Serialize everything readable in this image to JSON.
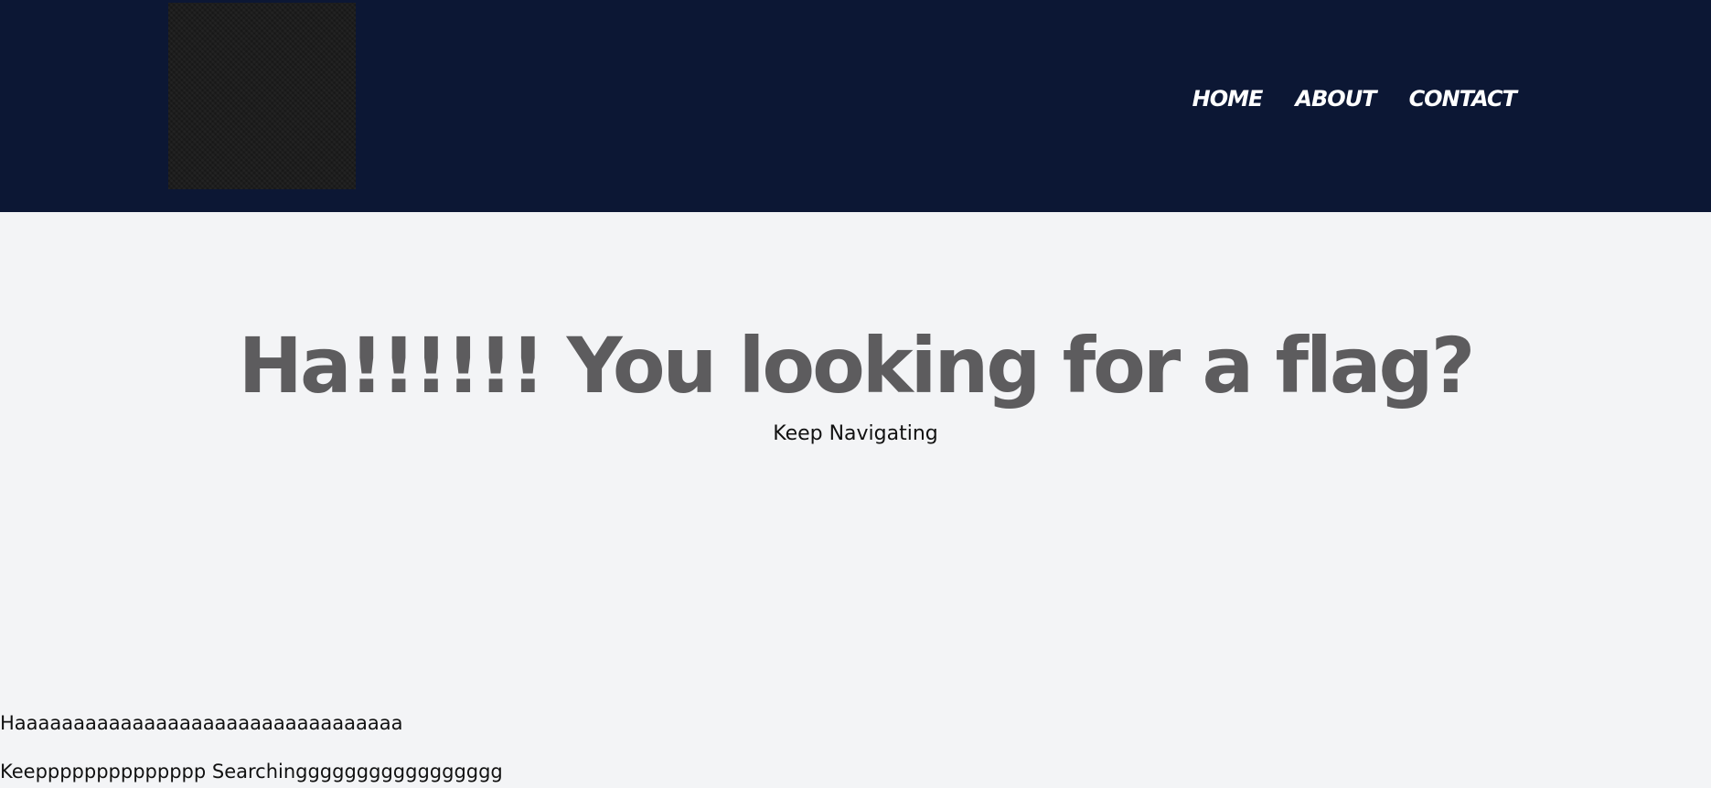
{
  "header": {
    "logo_name": "logo-image",
    "nav": [
      {
        "label": "HOME"
      },
      {
        "label": "ABOUT"
      },
      {
        "label": "CONTACT"
      }
    ]
  },
  "hero": {
    "title": "Ha!!!!!! You looking for a flag?",
    "subtitle": "Keep Navigating"
  },
  "content": {
    "line1": "Haaaaaaaaaaaaaaaaaaaaaaaaaaaaaaaaa",
    "line2": "Keepppppppppppppp Searchinggggggggggggggggg"
  },
  "colors": {
    "header_bg": "#0c1734",
    "page_bg": "#f3f4f6",
    "title": "#5d5c5e",
    "nav_text": "#ffffff"
  }
}
